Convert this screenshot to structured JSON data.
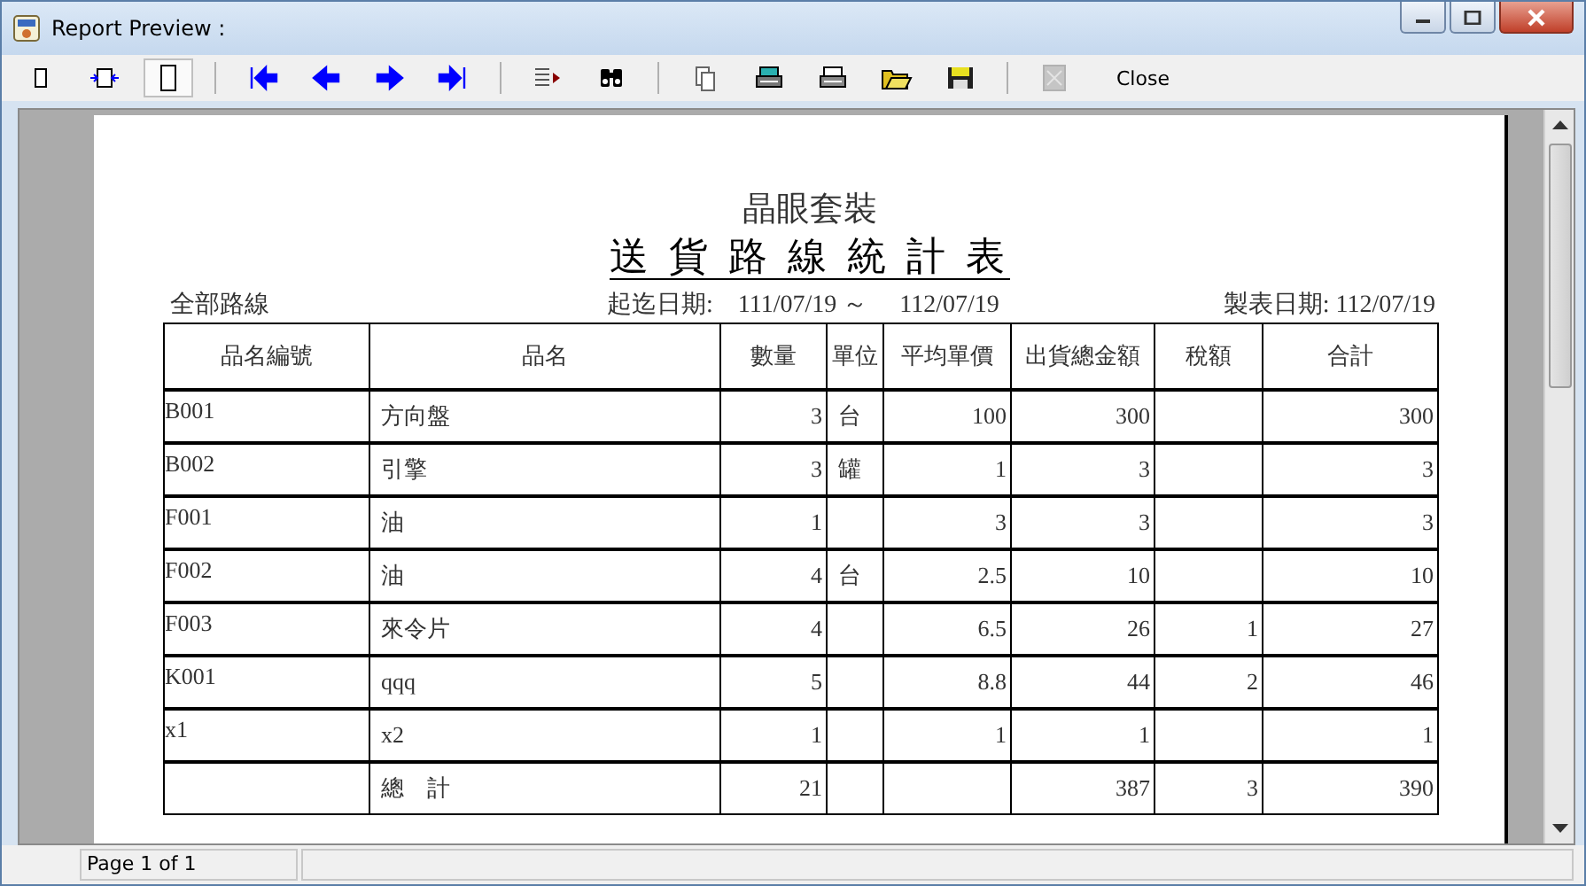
{
  "window": {
    "title": "Report Preview :"
  },
  "toolbar": [
    {
      "kind": "single-page",
      "selected": false
    },
    {
      "kind": "fit-width",
      "selected": false
    },
    {
      "kind": "full-page",
      "selected": true
    },
    {
      "kind": "sep"
    },
    {
      "kind": "first"
    },
    {
      "kind": "prev"
    },
    {
      "kind": "next"
    },
    {
      "kind": "last"
    },
    {
      "kind": "sep"
    },
    {
      "kind": "goto"
    },
    {
      "kind": "find"
    },
    {
      "kind": "sep"
    },
    {
      "kind": "copy"
    },
    {
      "kind": "setup"
    },
    {
      "kind": "print"
    },
    {
      "kind": "open"
    },
    {
      "kind": "save"
    },
    {
      "kind": "sep"
    },
    {
      "kind": "export",
      "disabled": true
    },
    {
      "kind": "text",
      "label": "Close"
    }
  ],
  "report": {
    "company": "晶眼套裝",
    "title": "送 貨 路 線 統 計 表",
    "route": "全部路線",
    "period_label": "起迄日期:",
    "period_from": "111/07/19 ～",
    "period_to": "112/07/19",
    "print_date": "製表日期: 112/07/19",
    "columns": [
      "品名編號",
      "品名",
      "數量",
      "單位",
      "平均單價",
      "出貨總金額",
      "稅額",
      "合計"
    ],
    "rows": [
      [
        "B001",
        "方向盤",
        "3",
        "台",
        "100",
        "300",
        null,
        "300"
      ],
      [
        "B002",
        "引擎",
        "3",
        "罐",
        "1",
        "3",
        null,
        "3"
      ],
      [
        "F001",
        "油",
        "1",
        null,
        "3",
        "3",
        null,
        "3"
      ],
      [
        "F002",
        "油",
        "4",
        "台",
        "2.5",
        "10",
        null,
        "10"
      ],
      [
        "F003",
        "來令片",
        "4",
        null,
        "6.5",
        "26",
        "1",
        "27"
      ],
      [
        "K001",
        "qqq",
        "5",
        null,
        "8.8",
        "44",
        "2",
        "46"
      ],
      [
        "x1",
        "x2",
        "1",
        null,
        "1",
        "1",
        null,
        "1"
      ]
    ],
    "total": {
      "label": "總　計",
      "quantity": "21",
      "amount": "387",
      "tax": "3",
      "sum": "390"
    }
  },
  "status_bar": {
    "page": "Page 1 of 1"
  }
}
